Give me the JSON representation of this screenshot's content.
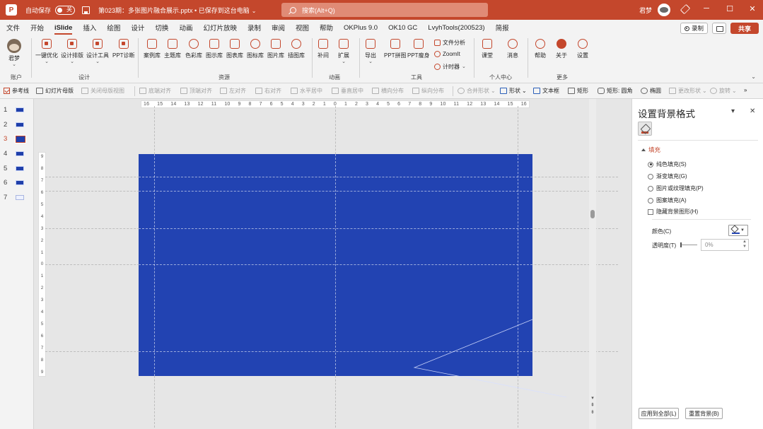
{
  "titlebar": {
    "autosave_label": "自动保存",
    "autosave_state": "关",
    "doc_title": "第023期：多张图片融合展示.pptx • 已保存到这台电脑",
    "search_placeholder": "搜索(Alt+Q)",
    "user_name": "君梦",
    "minimize": "─",
    "maximize": "☐",
    "close": "✕"
  },
  "menu": {
    "tabs": [
      "文件",
      "开始",
      "iSlide",
      "插入",
      "绘图",
      "设计",
      "切换",
      "动画",
      "幻灯片放映",
      "录制",
      "审阅",
      "视图",
      "帮助",
      "OKPlus 9.0",
      "OK10 GC",
      "LvyhTools(200523)",
      "简报"
    ],
    "active_tab": "iSlide",
    "record_label": "录制",
    "share_label": "共享"
  },
  "ribbon": {
    "account_btn": "君梦",
    "account_group": "账户",
    "design_btns": [
      "一键优化",
      "设计排版",
      "设计工具",
      "PPT诊断"
    ],
    "design_group": "设计",
    "resource_btns": [
      "案例库",
      "主题库",
      "色彩库",
      "图示库",
      "图表库",
      "图标库",
      "图片库",
      "插图库"
    ],
    "resource_group": "资源",
    "anim_btns": [
      "补间",
      "扩展"
    ],
    "anim_group": "动画",
    "tool_btns": [
      "导出",
      "PPT拼图",
      "PPT瘦身"
    ],
    "tool_small": [
      "文件分析",
      "ZoomIt",
      "计时器"
    ],
    "tool_group": "工具",
    "center_btns": [
      "课堂",
      "消息"
    ],
    "center_group": "个人中心",
    "more_btns": [
      "帮助",
      "关于",
      "设置"
    ],
    "more_group": "更多"
  },
  "qtoolbar": {
    "items": [
      "参考线",
      "幻灯片母版",
      "关闭母版视图",
      "底端对齐",
      "顶端对齐",
      "左对齐",
      "右对齐",
      "水平居中",
      "垂直居中",
      "横向分布",
      "纵向分布",
      "合并形状",
      "形状",
      "文本框",
      "矩形",
      "矩形: 圆角",
      "椭圆",
      "更改形状",
      "旋转"
    ]
  },
  "slides": {
    "numbers": [
      "1",
      "2",
      "3",
      "4",
      "5",
      "6",
      "7"
    ],
    "active_index": 3,
    "slide_color": "#2243b2"
  },
  "rulers": {
    "horizontal": [
      "16",
      "15",
      "14",
      "13",
      "12",
      "11",
      "10",
      "9",
      "8",
      "7",
      "6",
      "5",
      "4",
      "3",
      "2",
      "1",
      "0",
      "1",
      "2",
      "3",
      "4",
      "5",
      "6",
      "7",
      "8",
      "9",
      "10",
      "11",
      "12",
      "13",
      "14",
      "15",
      "16"
    ],
    "vertical": [
      "9",
      "8",
      "7",
      "6",
      "5",
      "4",
      "3",
      "2",
      "1",
      "0",
      "1",
      "2",
      "3",
      "4",
      "5",
      "6",
      "7",
      "8",
      "9"
    ]
  },
  "pane": {
    "title": "设置背景格式",
    "section": "填充",
    "options": [
      "纯色填充(S)",
      "渐变填充(G)",
      "图片或纹理填充(P)",
      "图案填充(A)"
    ],
    "checked_option": 0,
    "hide_bg_label": "隐藏背景图形(H)",
    "color_label": "颜色(C)",
    "transparency_label": "透明度(T)",
    "transparency_value": "0%",
    "apply_all": "应用到全部(L)",
    "reset_bg": "重置背景(B)",
    "accent": "#c4472c"
  }
}
